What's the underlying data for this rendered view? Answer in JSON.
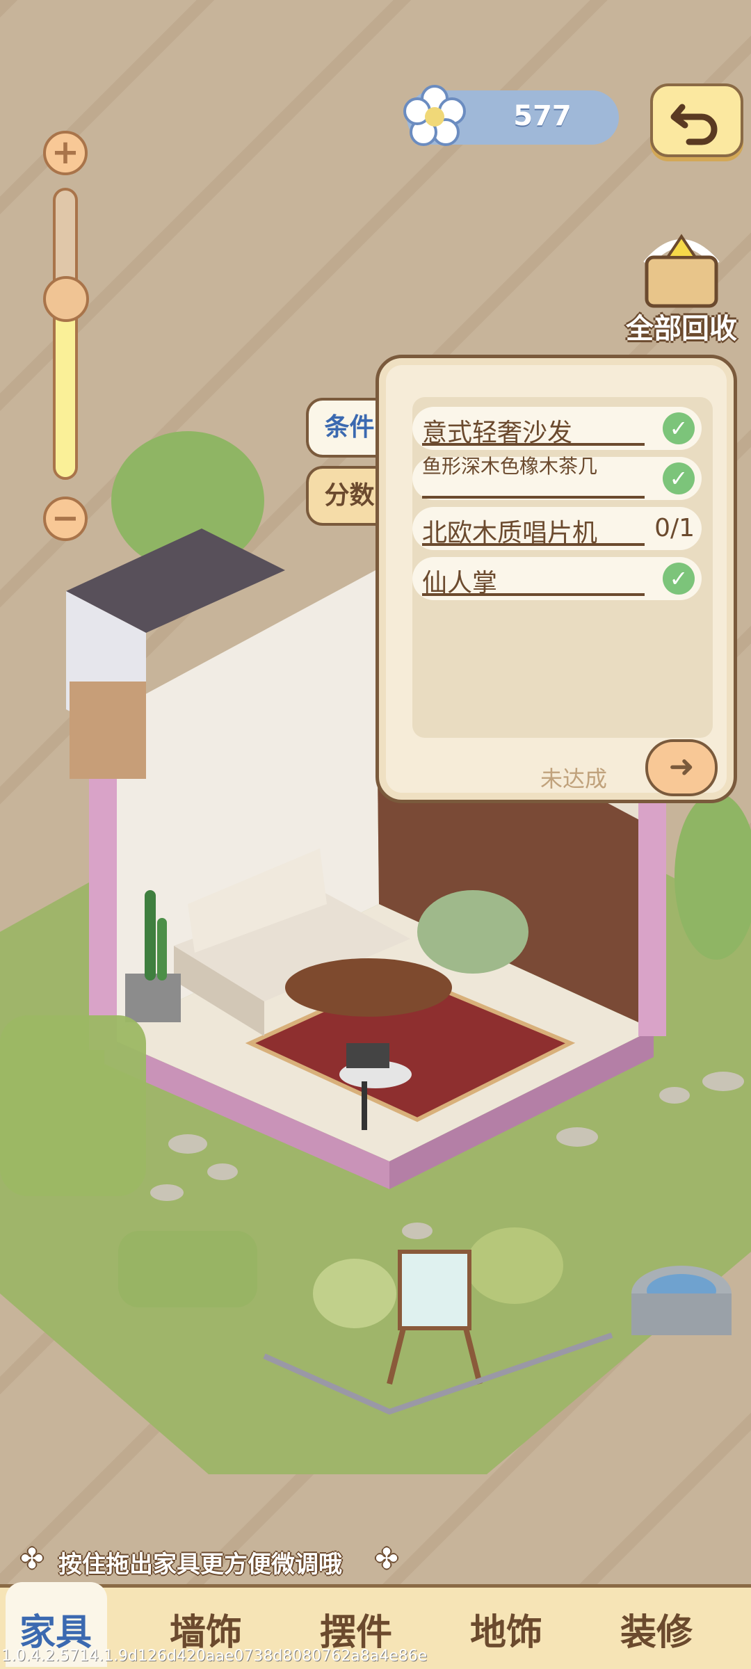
{
  "currency": {
    "value": "577",
    "icon": "flower-icon"
  },
  "recycle": {
    "label": "全部回收",
    "icon": "basket-icon"
  },
  "zoom": {
    "level": 0.62
  },
  "side_tabs": [
    {
      "label": "条件",
      "active": true
    },
    {
      "label": "分数",
      "active": false
    }
  ],
  "conditions": {
    "items": [
      {
        "name": "意式轻奢沙发",
        "done": true
      },
      {
        "name": "鱼形深木色橡木茶几",
        "done": true
      },
      {
        "name": "北欧木质唱片机",
        "done": false,
        "progress": "0/1"
      },
      {
        "name": "仙人掌",
        "done": true
      }
    ],
    "status": "未达成"
  },
  "hint": {
    "text": "按住拖出家具更方便微调哦"
  },
  "bottom_nav": {
    "items": [
      {
        "label": "家具",
        "active": true
      },
      {
        "label": "墙饰",
        "active": false
      },
      {
        "label": "摆件",
        "active": false
      },
      {
        "label": "地饰",
        "active": false
      },
      {
        "label": "装修",
        "active": false
      }
    ]
  },
  "version": "1.0.4.2.5714.1.9d126d420aae0738d8080762a8a4e86e",
  "colors": {
    "accent": "#3b69b0",
    "panel": "#f6ecd8",
    "check": "#7cc47a",
    "brown": "#6b4a2e"
  }
}
